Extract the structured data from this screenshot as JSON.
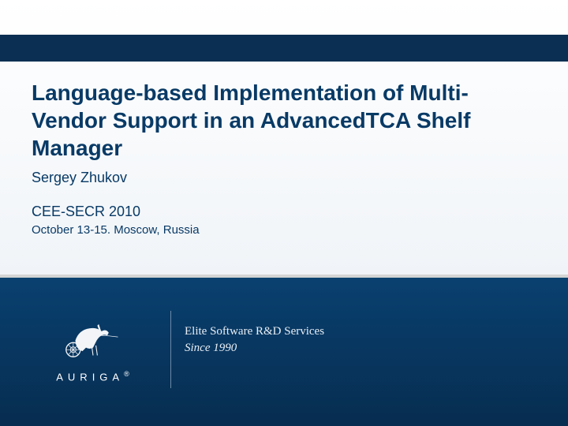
{
  "title": "Language-based Implementation of  Multi-Vendor Support in an AdvancedTCA Shelf Manager",
  "author": "Sergey Zhukov",
  "event": "CEE-SECR 2010",
  "date_location": "October 13-15. Moscow, Russia",
  "logo_text": "AURIGA",
  "tagline1": "Elite Software R&D Services",
  "tagline2": "Since 1990"
}
